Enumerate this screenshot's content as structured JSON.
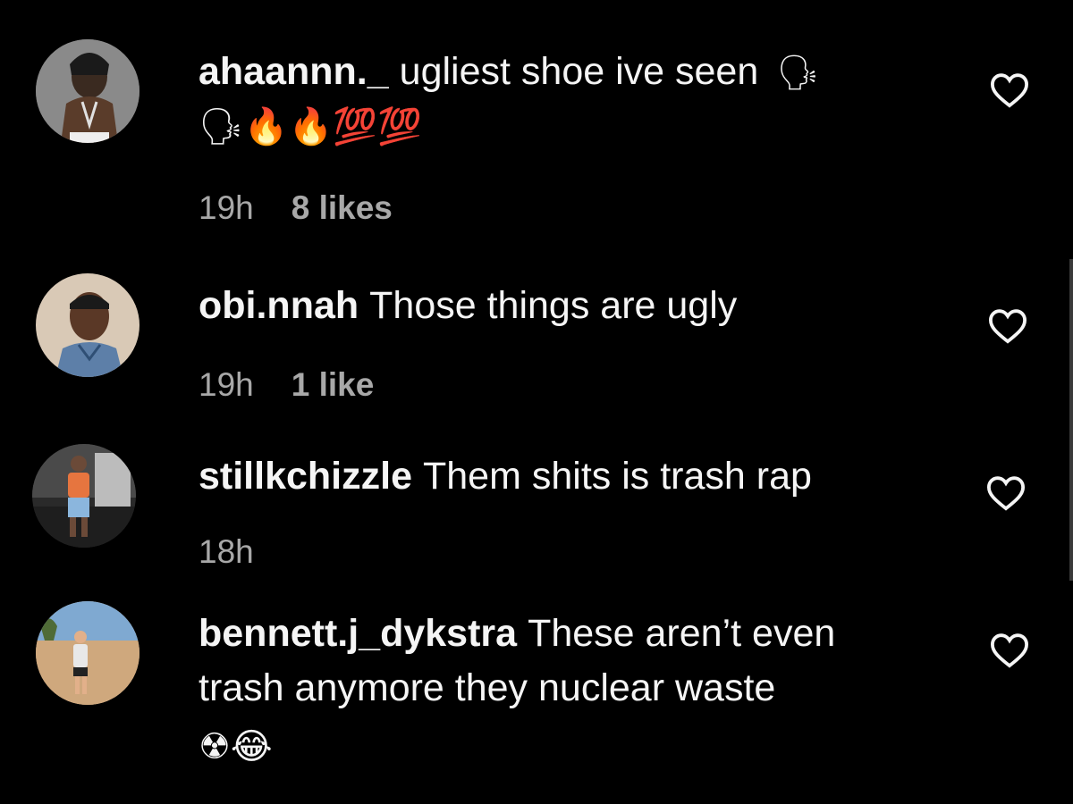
{
  "comments": [
    {
      "username": "ahaannn._",
      "text": "ugliest shoe ive seen",
      "text_emoji": "🗣",
      "emoji_line": "🗣🔥🔥💯💯",
      "time": "19h",
      "likes": "8 likes"
    },
    {
      "username": "obi.nnah",
      "text": "Those things are ugly",
      "time": "19h",
      "likes": "1 like"
    },
    {
      "username": "stillkchizzle",
      "text": "Them shits is trash rap",
      "time": "18h",
      "likes": ""
    },
    {
      "username": "bennett.j_dykstra",
      "text": "These aren’t even",
      "text_line2": "trash anymore they nuclear waste",
      "emoji_line": "☢😂",
      "time": "",
      "likes": ""
    }
  ],
  "icons": {
    "like": "heart-outline-icon"
  },
  "colors": {
    "background": "#000000",
    "primary_text": "#f5f5f5",
    "secondary_text": "#a8a8a8"
  }
}
